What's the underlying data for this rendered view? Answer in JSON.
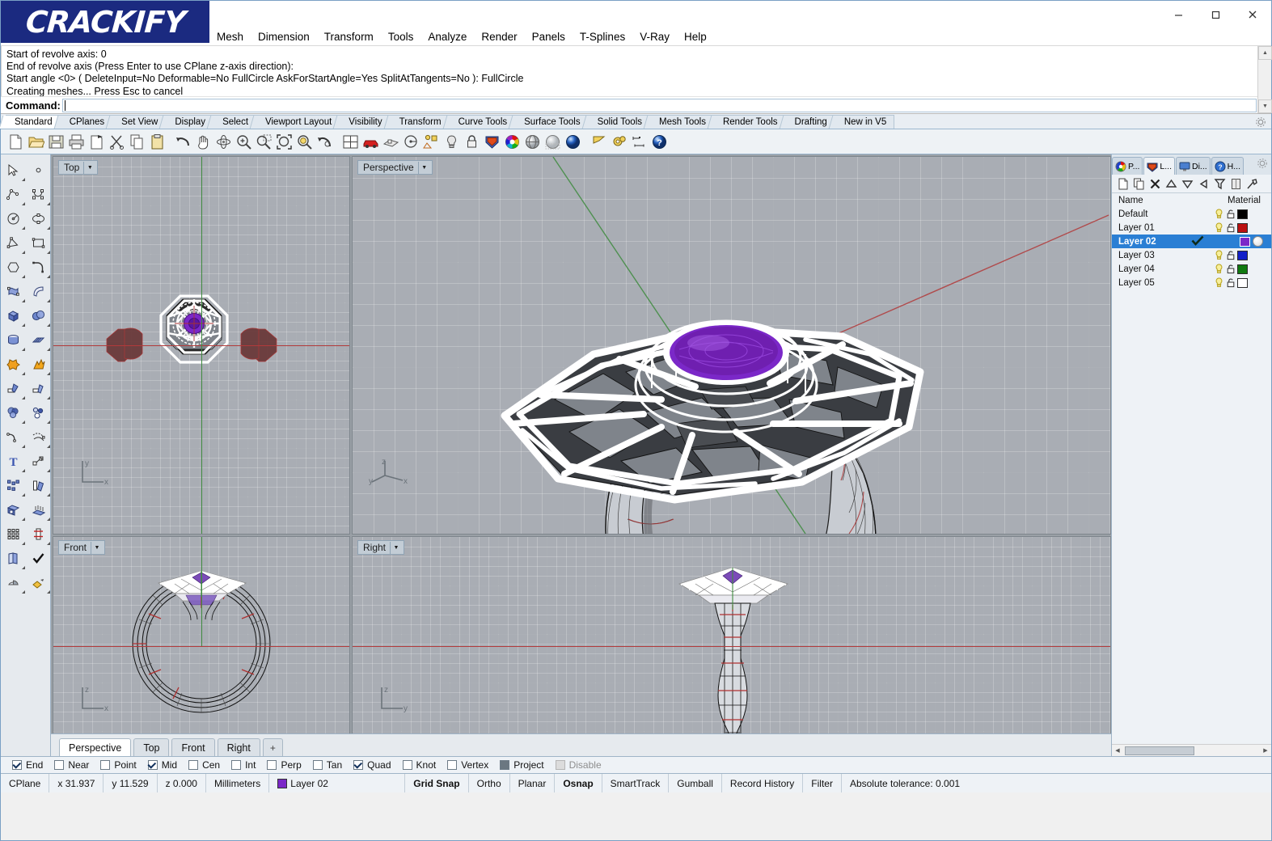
{
  "window": {
    "logo_text": "CRACKIFY",
    "minimize_label": "Minimize",
    "maximize_label": "Maximize",
    "close_label": "Close"
  },
  "menubar": {
    "items": [
      {
        "label": "Mesh"
      },
      {
        "label": "Dimension"
      },
      {
        "label": "Transform"
      },
      {
        "label": "Tools"
      },
      {
        "label": "Analyze"
      },
      {
        "label": "Render"
      },
      {
        "label": "Panels"
      },
      {
        "label": "T-Splines"
      },
      {
        "label": "V-Ray"
      },
      {
        "label": "Help"
      }
    ]
  },
  "command": {
    "history": [
      "Start of revolve axis: 0",
      "End of revolve axis (Press Enter to use CPlane z-axis direction):",
      "Start angle <0> ( DeleteInput=No  Deformable=No  FullCircle  AskForStartAngle=Yes  SplitAtTangents=No ): FullCircle",
      "Creating meshes... Press Esc to cancel"
    ],
    "prompt_label": "Command:",
    "input_value": "",
    "input_placeholder": ""
  },
  "toolbar_tabs": {
    "active": "Standard",
    "items": [
      {
        "label": "Standard"
      },
      {
        "label": "CPlanes"
      },
      {
        "label": "Set View"
      },
      {
        "label": "Display"
      },
      {
        "label": "Select"
      },
      {
        "label": "Viewport Layout"
      },
      {
        "label": "Visibility"
      },
      {
        "label": "Transform"
      },
      {
        "label": "Curve Tools"
      },
      {
        "label": "Surface Tools"
      },
      {
        "label": "Solid Tools"
      },
      {
        "label": "Mesh Tools"
      },
      {
        "label": "Render Tools"
      },
      {
        "label": "Drafting"
      },
      {
        "label": "New in V5"
      }
    ]
  },
  "main_toolbar": {
    "buttons": [
      {
        "name": "new-file-icon",
        "title": "New"
      },
      {
        "name": "open-file-icon",
        "title": "Open"
      },
      {
        "name": "save-icon",
        "title": "Save"
      },
      {
        "name": "print-icon",
        "title": "Print"
      },
      {
        "name": "cut-page-icon",
        "title": "Cut Page"
      },
      {
        "name": "scissors-icon",
        "title": "Cut"
      },
      {
        "name": "copy-icon",
        "title": "Copy"
      },
      {
        "name": "paste-icon",
        "title": "Paste"
      },
      {
        "name": "undo-icon",
        "title": "Undo"
      },
      {
        "name": "pan-hand-icon",
        "title": "Pan"
      },
      {
        "name": "rotate-view-icon",
        "title": "Rotate View"
      },
      {
        "name": "zoom-in-icon",
        "title": "Zoom In"
      },
      {
        "name": "zoom-out-icon",
        "title": "Zoom Out"
      },
      {
        "name": "zoom-extents-icon",
        "title": "Zoom Extents"
      },
      {
        "name": "zoom-selected-icon",
        "title": "Zoom Selected"
      },
      {
        "name": "zoom-previous-icon",
        "title": "Zoom Previous"
      },
      {
        "name": "four-viewport-icon",
        "title": "Viewport Layout"
      },
      {
        "name": "car-render-icon",
        "title": "Render"
      },
      {
        "name": "shade-icon",
        "title": "Shade"
      },
      {
        "name": "circle-target-icon",
        "title": "Named Views"
      },
      {
        "name": "object-properties-icon",
        "title": "Properties"
      },
      {
        "name": "light-bulb-icon",
        "title": "Light"
      },
      {
        "name": "lock-icon",
        "title": "Lock"
      },
      {
        "name": "layer-shield-icon",
        "title": "Layers"
      },
      {
        "name": "color-wheel-icon",
        "title": "Color"
      },
      {
        "name": "sphere-wire-icon",
        "title": "Wireframe"
      },
      {
        "name": "sphere-ghost-icon",
        "title": "Ghosted"
      },
      {
        "name": "sphere-render-icon",
        "title": "Rendered"
      },
      {
        "name": "flag-icon",
        "title": "Flag"
      },
      {
        "name": "gears-icon",
        "title": "Options"
      },
      {
        "name": "dimension-icon",
        "title": "Dimension"
      },
      {
        "name": "help-icon",
        "title": "Help"
      }
    ]
  },
  "left_toolbar": {
    "buttons": [
      {
        "name": "select-arrow-icon"
      },
      {
        "name": "point-icon"
      },
      {
        "name": "polyline-icon"
      },
      {
        "name": "control-point-curve-icon"
      },
      {
        "name": "circle-icon"
      },
      {
        "name": "ellipse-icon"
      },
      {
        "name": "triangle-polygon-icon"
      },
      {
        "name": "rectangle-icon"
      },
      {
        "name": "hexagon-icon"
      },
      {
        "name": "arc-corner-icon"
      },
      {
        "name": "surface-cv-icon"
      },
      {
        "name": "surface-sweep-icon"
      },
      {
        "name": "box-solid-icon"
      },
      {
        "name": "sphere-boolean-icon"
      },
      {
        "name": "cylinder-icon"
      },
      {
        "name": "mesh-plane-icon"
      },
      {
        "name": "boolean-union-icon"
      },
      {
        "name": "explode-icon"
      },
      {
        "name": "trim-icon"
      },
      {
        "name": "split-icon"
      },
      {
        "name": "circles-union-icon"
      },
      {
        "name": "circles-offset-icon"
      },
      {
        "name": "fillet-curve-icon"
      },
      {
        "name": "offset-curve-icon"
      },
      {
        "name": "text-tool-icon"
      },
      {
        "name": "move-point-icon"
      },
      {
        "name": "array-icon"
      },
      {
        "name": "mirror-icon"
      },
      {
        "name": "cap-solid-icon"
      },
      {
        "name": "extrude-surface-icon"
      },
      {
        "name": "grid-array-icon"
      },
      {
        "name": "rebuild-icon"
      },
      {
        "name": "copy-object-icon"
      },
      {
        "name": "checkmark-icon"
      },
      {
        "name": "shade-object-icon"
      },
      {
        "name": "render-material-icon"
      }
    ]
  },
  "viewports": [
    {
      "name": "top",
      "label": "Top"
    },
    {
      "name": "perspective",
      "label": "Perspective"
    },
    {
      "name": "front",
      "label": "Front"
    },
    {
      "name": "right",
      "label": "Right"
    }
  ],
  "viewport_tabs": {
    "active": "Perspective",
    "items": [
      {
        "label": "Perspective"
      },
      {
        "label": "Top"
      },
      {
        "label": "Front"
      },
      {
        "label": "Right"
      },
      {
        "label": "+"
      }
    ]
  },
  "layers_panel": {
    "tabs": [
      {
        "label": "P...",
        "icon": "properties-icon",
        "active": false
      },
      {
        "label": "L...",
        "icon": "layers-icon",
        "active": true
      },
      {
        "label": "Di...",
        "icon": "display-icon",
        "active": false
      },
      {
        "label": "H...",
        "icon": "help-icon",
        "active": false
      }
    ],
    "toolbar_buttons": [
      {
        "name": "new-layer-icon"
      },
      {
        "name": "duplicate-layer-icon"
      },
      {
        "name": "delete-layer-icon"
      },
      {
        "name": "move-layer-up-icon"
      },
      {
        "name": "move-layer-down-icon"
      },
      {
        "name": "select-objects-icon"
      },
      {
        "name": "filter-icon"
      },
      {
        "name": "properties-page-icon"
      },
      {
        "name": "layer-tools-icon"
      }
    ],
    "columns": {
      "name": "Name",
      "material": "Material"
    },
    "rows": [
      {
        "name": "Default",
        "visible": true,
        "locked": false,
        "color": "#000000",
        "selected": false,
        "current": false
      },
      {
        "name": "Layer 01",
        "visible": true,
        "locked": false,
        "color": "#bb1111",
        "selected": false,
        "current": false
      },
      {
        "name": "Layer 02",
        "visible": true,
        "locked": false,
        "color": "#7b28c8",
        "selected": true,
        "current": true
      },
      {
        "name": "Layer 03",
        "visible": true,
        "locked": false,
        "color": "#1320c8",
        "selected": false,
        "current": false
      },
      {
        "name": "Layer 04",
        "visible": true,
        "locked": false,
        "color": "#107a10",
        "selected": false,
        "current": false
      },
      {
        "name": "Layer 05",
        "visible": true,
        "locked": false,
        "color": "#ffffff",
        "selected": false,
        "current": false
      }
    ]
  },
  "osnap": {
    "items": [
      {
        "label": "End",
        "state": "checked"
      },
      {
        "label": "Near",
        "state": "unchecked"
      },
      {
        "label": "Point",
        "state": "unchecked"
      },
      {
        "label": "Mid",
        "state": "checked"
      },
      {
        "label": "Cen",
        "state": "unchecked"
      },
      {
        "label": "Int",
        "state": "unchecked"
      },
      {
        "label": "Perp",
        "state": "unchecked"
      },
      {
        "label": "Tan",
        "state": "unchecked"
      },
      {
        "label": "Quad",
        "state": "checked"
      },
      {
        "label": "Knot",
        "state": "unchecked"
      },
      {
        "label": "Vertex",
        "state": "unchecked"
      },
      {
        "label": "Project",
        "state": "filled"
      },
      {
        "label": "Disable",
        "state": "disabled"
      }
    ]
  },
  "statusbar": {
    "cplane": "CPlane",
    "x": "x 31.937",
    "y": "y 11.529",
    "z": "z 0.000",
    "units": "Millimeters",
    "layer": "Layer 02",
    "layer_color": "#7b28c8",
    "grid_snap": "Grid Snap",
    "ortho": "Ortho",
    "planar": "Planar",
    "osnap": "Osnap",
    "smarttrack": "SmartTrack",
    "gumball": "Gumball",
    "record_history": "Record History",
    "filter": "Filter",
    "tolerance": "Absolute tolerance: 0.001"
  },
  "colors": {
    "accent": "#2a7fd4",
    "gem": "#6f1fb0",
    "viewport_bg": "#a9adb4",
    "logo_bg": "#1b2a80",
    "axis_x": "#b23a3a",
    "axis_y": "#3f8b3f"
  }
}
